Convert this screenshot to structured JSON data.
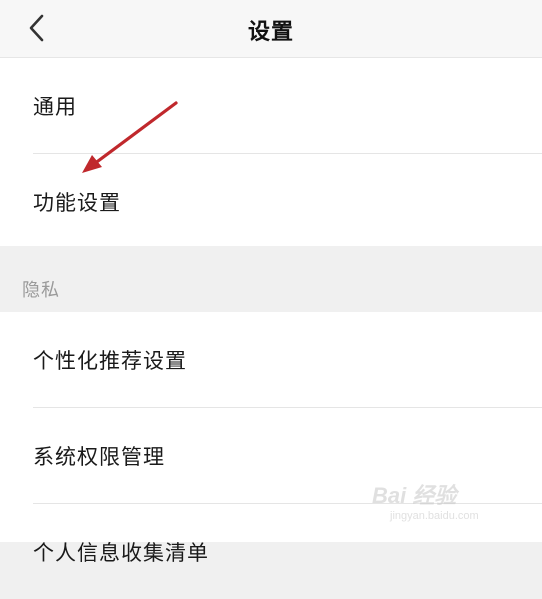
{
  "header": {
    "title": "设置",
    "back_icon": "chevron-left-icon"
  },
  "general_group": {
    "items": [
      {
        "label": "通用"
      },
      {
        "label": "功能设置"
      }
    ]
  },
  "privacy_section": {
    "title": "隐私",
    "items": [
      {
        "label": "个性化推荐设置"
      },
      {
        "label": "系统权限管理"
      },
      {
        "label": "个人信息收集清单"
      }
    ]
  },
  "annotation": {
    "arrow_color": "#c0282c",
    "arrow_icon": "red-arrow-annotation"
  },
  "watermark": {
    "text": "Bai 经验",
    "url_text": "jingyan.baidu.com"
  },
  "colors": {
    "background": "#f0f0f0",
    "card": "#ffffff",
    "text": "#1a1a1a",
    "section_label": "#9a9a9a",
    "divider": "#e5e5e5"
  }
}
